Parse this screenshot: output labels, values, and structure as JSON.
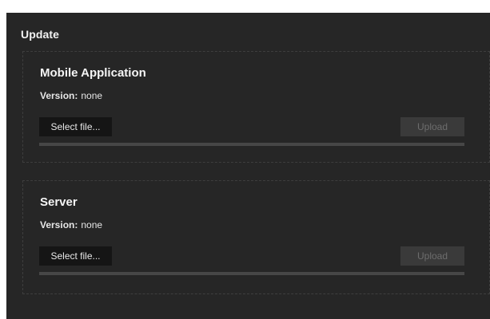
{
  "panel": {
    "title": "Update"
  },
  "sections": [
    {
      "title": "Mobile Application",
      "version_label": "Version:",
      "version_value": "none",
      "select_label": "Select file...",
      "upload_label": "Upload",
      "progress": 0
    },
    {
      "title": "Server",
      "version_label": "Version:",
      "version_value": "none",
      "select_label": "Select file...",
      "upload_label": "Upload",
      "progress": 0
    }
  ]
}
